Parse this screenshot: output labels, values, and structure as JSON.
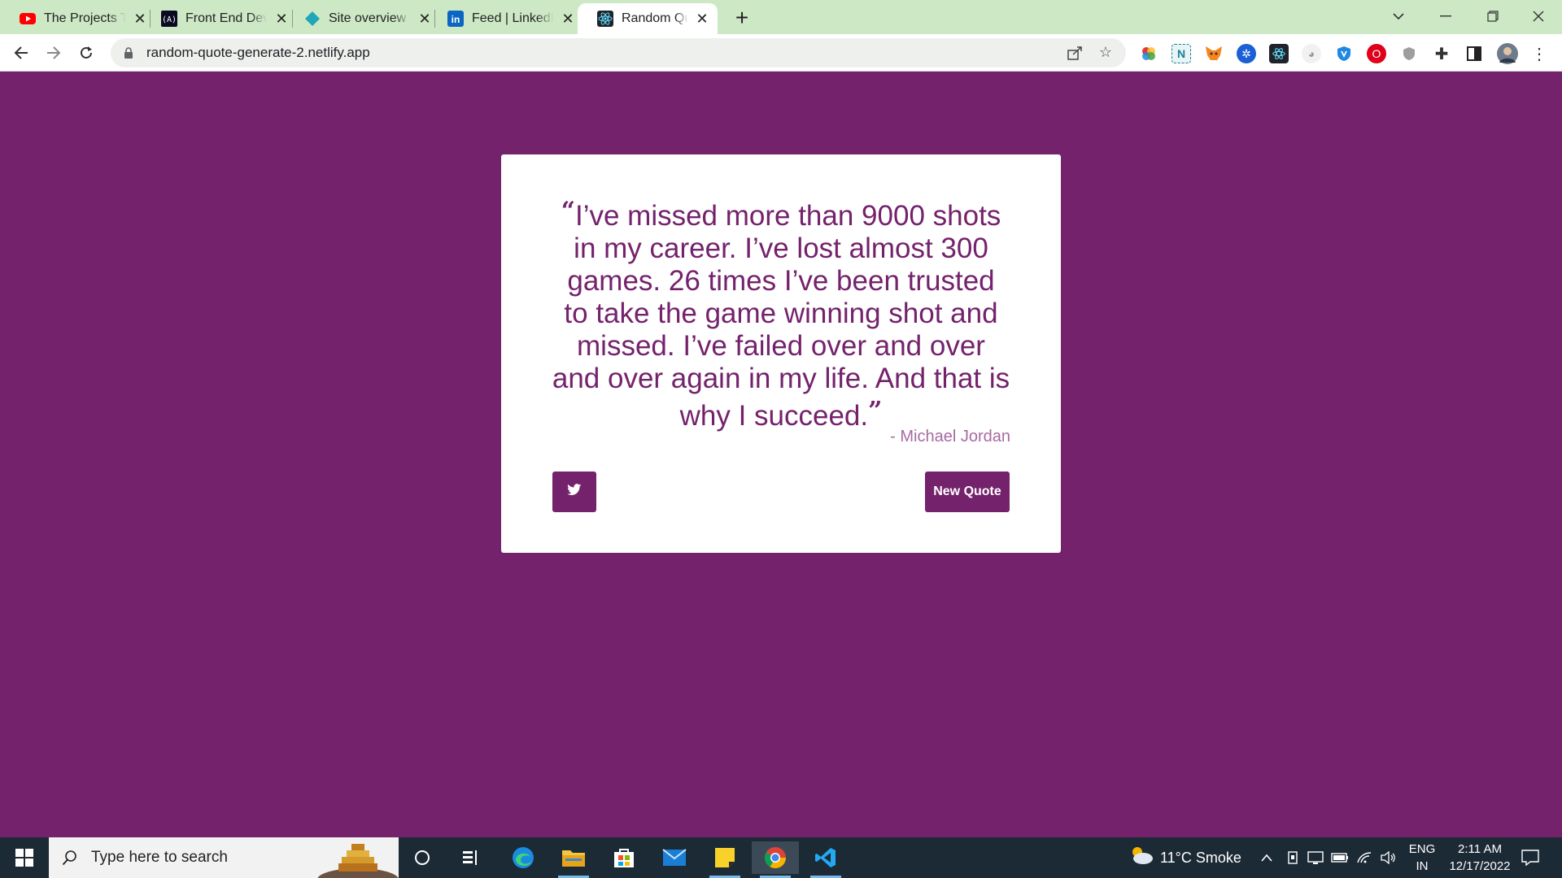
{
  "browser": {
    "tabs": [
      {
        "title": "The Projects Th",
        "icon": "youtube-icon"
      },
      {
        "title": "Front End Dev",
        "icon": "freecodecamp-icon"
      },
      {
        "title": "Site overview |",
        "icon": "netlify-icon"
      },
      {
        "title": "Feed | LinkedIn",
        "icon": "linkedin-icon"
      },
      {
        "title": "Random Quote",
        "icon": "react-icon",
        "active": true
      }
    ],
    "url": "random-quote-generate-2.netlify.app"
  },
  "quote": {
    "open_mark": "“",
    "text": "I’ve missed more than 9000 shots in my career. I’ve lost almost 300 games. 26 times I’ve been trusted to take the game winning shot and missed. I’ve failed over and over and over again in my life. And that is why I succeed.",
    "close_mark": "”",
    "author": "- Michael Jordan",
    "new_quote_label": "New Quote",
    "tweet_icon": "twitter-icon"
  },
  "taskbar": {
    "search_placeholder": "Type here to search",
    "weather": "11°C  Smoke",
    "language_top": "ENG",
    "language_bottom": "IN",
    "time": "2:11 AM",
    "date": "12/17/2022"
  },
  "colors": {
    "page_background": "#74226c",
    "accent": "#74226c",
    "author": "#a86aa2",
    "tab_strip": "#cde8c5"
  }
}
